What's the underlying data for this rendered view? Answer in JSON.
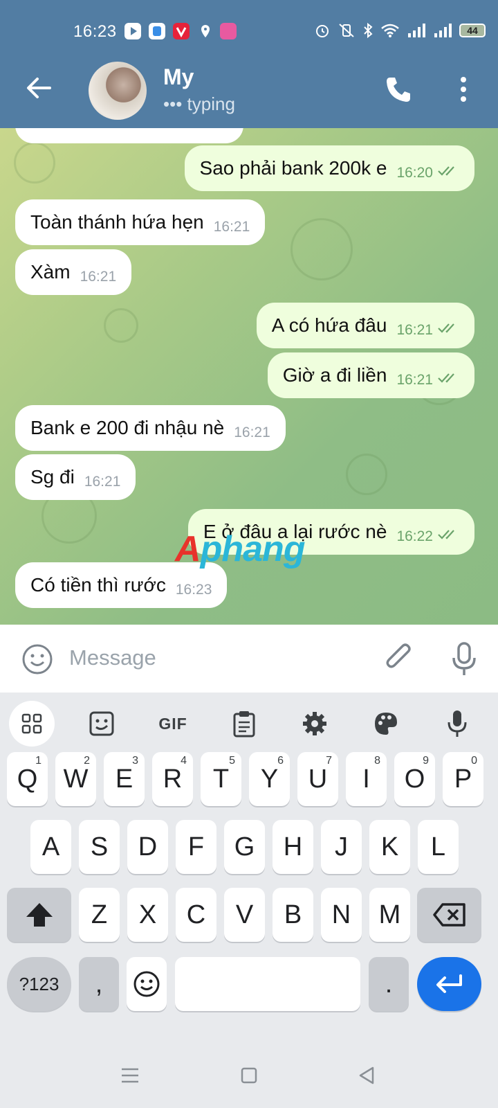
{
  "status": {
    "time": "16:23",
    "battery": "44",
    "colors": {
      "bar": "#527da3"
    }
  },
  "header": {
    "name": "My",
    "status": "typing"
  },
  "messages": [
    {
      "dir": "out",
      "text": "Sao phải bank 200k e",
      "time": "16:20"
    },
    {
      "dir": "in",
      "text": "Toàn thánh hứa hẹn",
      "time": "16:21"
    },
    {
      "dir": "in",
      "text": "Xàm",
      "time": "16:21"
    },
    {
      "dir": "out",
      "text": "A có hứa đâu",
      "time": "16:21"
    },
    {
      "dir": "out",
      "text": "Giờ a đi liền",
      "time": "16:21"
    },
    {
      "dir": "in",
      "text": "Bank e 200 đi nhậu nè",
      "time": "16:21"
    },
    {
      "dir": "in",
      "text": "Sg đi",
      "time": "16:21"
    },
    {
      "dir": "out",
      "text": "E ở đâu a lại rước nè",
      "time": "16:22"
    },
    {
      "dir": "in",
      "text": "Có tiền thì rước",
      "time": "16:23"
    }
  ],
  "watermark": {
    "part1": "A",
    "part2": "phang"
  },
  "composer": {
    "placeholder": "Message"
  },
  "keyboard": {
    "toolbar": {
      "gif": "GIF"
    },
    "row1": [
      {
        "k": "Q",
        "h": "1"
      },
      {
        "k": "W",
        "h": "2"
      },
      {
        "k": "E",
        "h": "3"
      },
      {
        "k": "R",
        "h": "4"
      },
      {
        "k": "T",
        "h": "5"
      },
      {
        "k": "Y",
        "h": "6"
      },
      {
        "k": "U",
        "h": "7"
      },
      {
        "k": "I",
        "h": "8"
      },
      {
        "k": "O",
        "h": "9"
      },
      {
        "k": "P",
        "h": "0"
      }
    ],
    "row2": [
      "A",
      "S",
      "D",
      "F",
      "G",
      "H",
      "J",
      "K",
      "L"
    ],
    "row3": [
      "Z",
      "X",
      "C",
      "V",
      "B",
      "N",
      "M"
    ],
    "sym": "?123",
    "comma": ",",
    "period": "."
  },
  "colors": {
    "outgoing_bubble": "#effedd",
    "incoming_bubble": "#ffffff",
    "enter_key": "#1a73e8"
  }
}
